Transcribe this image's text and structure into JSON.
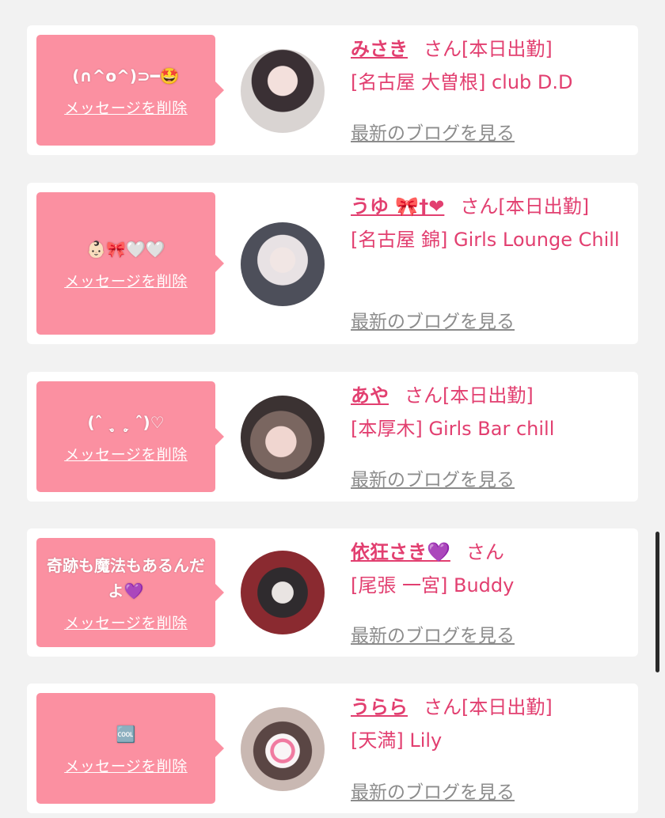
{
  "entries": [
    {
      "message": "(∩^o^)⊃━🤩",
      "delete_label": "メッセージを削除",
      "name": "みさき",
      "honorific": "さん",
      "status": "[本日出勤]",
      "store": "[名古屋 大曽根] club D.D",
      "blog_link": "最新のブログを見る"
    },
    {
      "message": "👶🏻🎀🤍🤍",
      "delete_label": "メッセージを削除",
      "name": "うゆ 🎀†❤",
      "honorific": "さん",
      "status": "[本日出勤]",
      "store": "[名古屋 錦] Girls Lounge Chill",
      "blog_link": "最新のブログを見る"
    },
    {
      "message": "(ˆ ˎ̥ ˏ̥ ˆ)♡",
      "delete_label": "メッセージを削除",
      "name": "あや",
      "honorific": "さん",
      "status": "[本日出勤]",
      "store": "[本厚木] Girls Bar chill",
      "blog_link": "最新のブログを見る"
    },
    {
      "message": "奇跡も魔法もあるんだよ💜",
      "delete_label": "メッセージを削除",
      "name": "依狂さき💜",
      "honorific": "さん",
      "status": "",
      "store": "[尾張 一宮] Buddy",
      "blog_link": "最新のブログを見る"
    },
    {
      "message": "🆒",
      "delete_label": "メッセージを削除",
      "name": "うらら",
      "honorific": "さん",
      "status": "[本日出勤]",
      "store": "[天満] Lily",
      "blog_link": "最新のブログを見る"
    }
  ],
  "colors": {
    "accent": "#e23f70",
    "bubble": "#fb90a1",
    "link_gray": "#8c8c8c",
    "background": "#f2f2f2"
  }
}
